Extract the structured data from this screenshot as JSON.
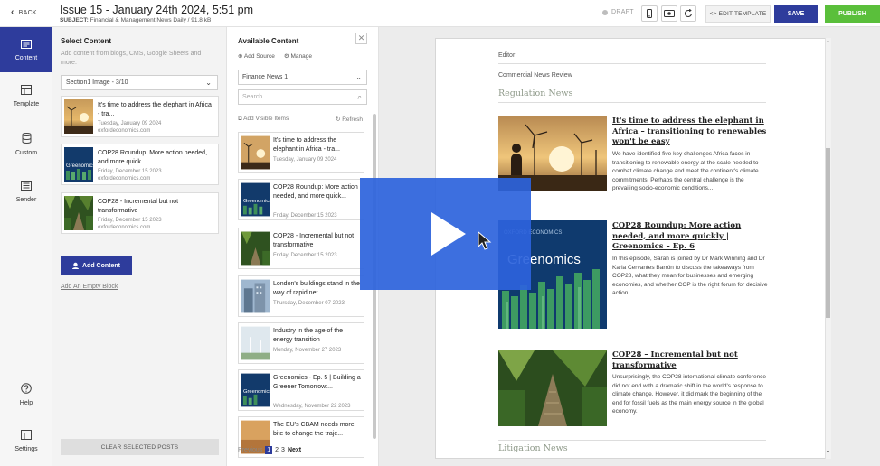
{
  "header": {
    "back_label": "BACK",
    "title": "Issue 15 - January 24th 2024, 5:51 pm",
    "subject_label": "SUBJECT:",
    "subject_value": "Financial & Management News Daily / 91.8 kB",
    "status": "DRAFT",
    "edit_template_label": "<> EDIT TEMPLATE",
    "save_label": "SAVE",
    "publish_label": "PUBLISH",
    "status_color": "#bdbdbd",
    "save_color": "#2e3c9c",
    "publish_color": "#5abf3b"
  },
  "rail": {
    "items": [
      {
        "label": "Content",
        "icon": "content-icon",
        "active": true
      },
      {
        "label": "Template",
        "icon": "template-icon"
      },
      {
        "label": "Custom",
        "icon": "database-icon"
      },
      {
        "label": "Sender",
        "icon": "sender-icon"
      },
      {
        "label": "Help",
        "icon": "help-icon"
      },
      {
        "label": "Settings",
        "icon": "settings-icon"
      }
    ]
  },
  "select_panel": {
    "title": "Select Content",
    "description": "Add content from blogs, CMS, Google Sheets and more.",
    "dropdown_value": "Section1 Image - 3/10",
    "cards": [
      {
        "title": "It's time to address the elephant in Africa - tra...",
        "date": "Tuesday, January 09 2024",
        "source": "oxfordeconomics.com"
      },
      {
        "title": "COP28 Roundup: More action needed, and more quick...",
        "date": "Friday, December 15 2023",
        "source": "oxfordeconomics.com"
      },
      {
        "title": "COP28 - Incremental but not transformative",
        "date": "Friday, December 15 2023",
        "source": "oxfordeconomics.com"
      }
    ],
    "add_content_label": "Add Content",
    "add_empty_label": "Add An Empty Block",
    "clear_label": "CLEAR SELECTED POSTS"
  },
  "available": {
    "title": "Available Content",
    "add_source_label": "Add Source",
    "manage_label": "Manage",
    "feed_value": "Finance News 1",
    "search_placeholder": "Search...",
    "add_visible_label": "Add Visible Items",
    "refresh_label": "Refresh",
    "items": [
      {
        "title": "It's time to address the elephant in Africa - tra...",
        "date": "Tuesday, January 09 2024"
      },
      {
        "title": "COP28 Roundup: More action needed, and more quick...",
        "date": "Friday, December 15 2023"
      },
      {
        "title": "COP28 - Incremental but not transformative",
        "date": "Friday, December 15 2023"
      },
      {
        "title": "London's buildings stand in the way of rapid net...",
        "date": "Thursday, December 07 2023"
      },
      {
        "title": "Industry in the age of the energy transition",
        "date": "Monday, November 27 2023"
      },
      {
        "title": "Greenomics - Ep. 5 | Building a Greener Tomorrow:...",
        "date": "Wednesday, November 22 2023"
      },
      {
        "title": "The EU's CBAM needs more bite to change the traje...",
        "date": ""
      }
    ],
    "pager": {
      "prev": "Previous",
      "pages": [
        "1",
        "2",
        "3"
      ],
      "next": "Next"
    }
  },
  "preview": {
    "editor_label": "Editor",
    "review_label": "Commercial News Review",
    "section1": "Regulation News",
    "section2": "Litigation News",
    "articles": [
      {
        "headline": "It's time to address the elephant in Africa – transitioning to renewables won't be easy",
        "body": "We have identified five key challenges Africa faces in transitioning to renewable energy at the scale needed to combat climate change and meet the continent's climate commitments. Perhaps the central challenge is the prevailing socio-economic conditions..."
      },
      {
        "headline": "COP28 Roundup: More action needed, and more quickly | Greenomics – Ep. 6",
        "body": "In this episode, Sarah is joined by Dr Mark Winning and Dr Karla Cervantes Barrón to discuss the takeaways from COP28, what they mean for businesses and emerging economies, and whether COP is the right forum for decisive action."
      },
      {
        "headline": "COP28 – Incremental but not transformative",
        "body": "Unsurprisingly, the COP28 international climate conference did not end with a dramatic shift in the world's response to climate change. However, it did mark the beginning of the end for fossil fuels as the main energy source in the global economy."
      }
    ],
    "greenomics_brand": "OXFORD ECONOMICS",
    "greenomics_title": "Greenomics"
  },
  "overlay": {
    "play_color": "#2c63dc"
  }
}
